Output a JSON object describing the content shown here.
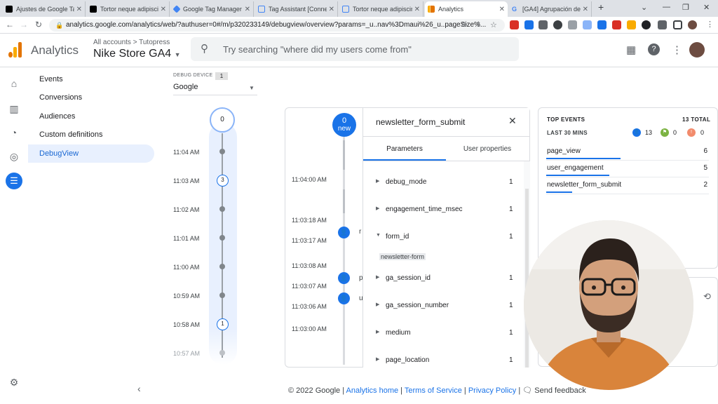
{
  "browser": {
    "tabs": [
      {
        "title": "Ajustes de Google Tag",
        "color": "#000000"
      },
      {
        "title": "Tortor neque adipiscin",
        "color": "#000000"
      },
      {
        "title": "Google Tag Manager",
        "color": "#4285f4"
      },
      {
        "title": "Tag Assistant [Connec",
        "color": "#4285f4"
      },
      {
        "title": "Tortor neque adipiscin",
        "color": "#4285f4"
      },
      {
        "title": "Analytics",
        "color": "#f9ab00"
      },
      {
        "title": "[GA4] Agrupación de",
        "color": "#4285f4"
      }
    ],
    "url": "analytics.google.com/analytics/web/?authuser=0#/m/p320233149/debugview/overview?params=_u..nav%3Dmaui%26_u..pageSize%..."
  },
  "header": {
    "product": "Analytics",
    "breadcrumb": "All accounts > Tutopress",
    "property": "Nike Store GA4",
    "search_placeholder": "Try searching \"where did my users come from\""
  },
  "sidebar": {
    "items": [
      {
        "label": "Events"
      },
      {
        "label": "Conversions"
      },
      {
        "label": "Audiences"
      },
      {
        "label": "Custom definitions"
      },
      {
        "label": "DebugView"
      }
    ]
  },
  "debug_device": {
    "label": "DEBUG DEVICE",
    "count": "1",
    "selected": "Google"
  },
  "minutes_stream": {
    "top_count": "0",
    "times": [
      "11:04 AM",
      "11:03 AM",
      "11:02 AM",
      "11:01 AM",
      "11:00 AM",
      "10:59 AM",
      "10:58 AM",
      "10:57 AM"
    ],
    "counts": [
      "3",
      "1"
    ]
  },
  "seconds_stream": {
    "new_count": "0",
    "new_label": "new",
    "times": [
      "11:04:00 AM",
      "11:03:18 AM",
      "11:03:17 AM",
      "11:03:08 AM",
      "11:03:07 AM",
      "11:03:06 AM",
      "11:03:00 AM"
    ],
    "fragments": [
      "r",
      "p",
      "u"
    ]
  },
  "event_panel": {
    "title": "newsletter_form_submit",
    "tabs": [
      "Parameters",
      "User properties"
    ],
    "params": [
      {
        "name": "debug_mode",
        "count": "1"
      },
      {
        "name": "engagement_time_msec",
        "count": "1"
      },
      {
        "name": "form_id",
        "count": "1"
      },
      {
        "name": "ga_session_id",
        "count": "1"
      },
      {
        "name": "ga_session_number",
        "count": "1"
      },
      {
        "name": "medium",
        "count": "1"
      },
      {
        "name": "page_location",
        "count": "1"
      }
    ],
    "form_id_value": "newsletter-form"
  },
  "top_events": {
    "title": "TOP EVENTS",
    "total": "13 TOTAL",
    "period": "LAST 30 MINS",
    "badges": [
      {
        "value": "13",
        "color": "#1a73e8"
      },
      {
        "value": "0",
        "color": "#7cb342"
      },
      {
        "value": "0",
        "color": "#f28b6c"
      }
    ],
    "rows": [
      {
        "name": "page_view",
        "count": "6"
      },
      {
        "name": "user_engagement",
        "count": "5"
      },
      {
        "name": "newsletter_form_submit",
        "count": "2"
      }
    ]
  },
  "footer": {
    "copyright": "© 2022 Google |",
    "analytics_home": "Analytics home",
    "terms": "Terms of Service",
    "privacy": "Privacy Policy",
    "feedback": "Send feedback"
  }
}
